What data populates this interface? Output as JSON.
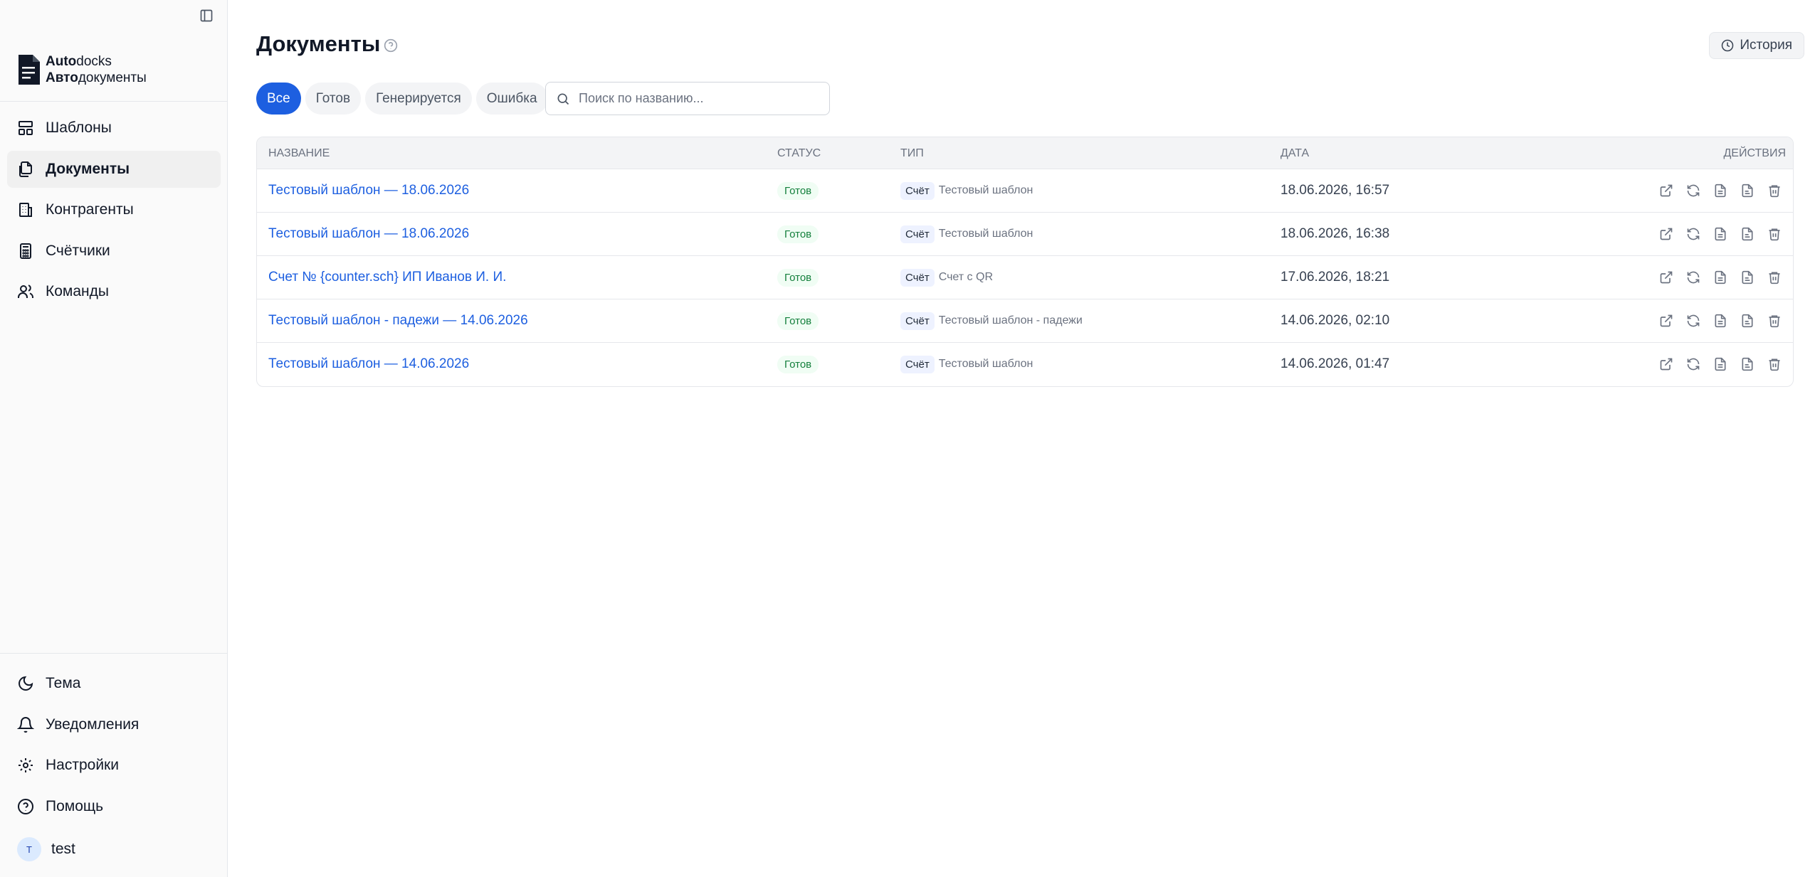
{
  "sidebar": {
    "logo": {
      "line1_bold": "Auto",
      "line1_rest": "docks",
      "line2_bold": "Авто",
      "line2_rest": "документы"
    },
    "nav": [
      {
        "label": "Шаблоны",
        "icon": "layout-icon",
        "active": false
      },
      {
        "label": "Документы",
        "icon": "documents-icon",
        "active": true
      },
      {
        "label": "Контрагенты",
        "icon": "building-icon",
        "active": false
      },
      {
        "label": "Счётчики",
        "icon": "calculator-icon",
        "active": false
      },
      {
        "label": "Команды",
        "icon": "users-icon",
        "active": false
      }
    ],
    "bottom_nav": [
      {
        "label": "Тема",
        "icon": "moon-icon"
      },
      {
        "label": "Уведомления",
        "icon": "bell-icon"
      },
      {
        "label": "Настройки",
        "icon": "gear-icon"
      },
      {
        "label": "Помощь",
        "icon": "help-circle-icon"
      }
    ],
    "user": {
      "initial": "T",
      "name": "test"
    }
  },
  "header": {
    "title": "Документы",
    "history_label": "История"
  },
  "filters": {
    "tabs": [
      "Все",
      "Готов",
      "Генерируется",
      "Ошибка"
    ],
    "active_index": 0,
    "search_placeholder": "Поиск по названию..."
  },
  "table": {
    "columns": {
      "name": "Название",
      "status": "Статус",
      "type": "Тип",
      "date": "Дата",
      "actions": "Действия"
    },
    "rows": [
      {
        "name": "Тестовый шаблон — 18.06.2026",
        "status": "Готов",
        "type": "Счёт",
        "template": "Тестовый шаблон",
        "date": "18.06.2026, 16:57"
      },
      {
        "name": "Тестовый шаблон — 18.06.2026",
        "status": "Готов",
        "type": "Счёт",
        "template": "Тестовый шаблон",
        "date": "18.06.2026, 16:38"
      },
      {
        "name": "Счет № {counter.sch} ИП Иванов И. И.",
        "status": "Готов",
        "type": "Счёт",
        "template": "Счет с QR",
        "date": "17.06.2026, 18:21"
      },
      {
        "name": "Тестовый шаблон - падежи — 14.06.2026",
        "status": "Готов",
        "type": "Счёт",
        "template": "Тестовый шаблон - падежи",
        "date": "14.06.2026, 02:10"
      },
      {
        "name": "Тестовый шаблон — 14.06.2026",
        "status": "Готов",
        "type": "Счёт",
        "template": "Тестовый шаблон",
        "date": "14.06.2026, 01:47"
      }
    ],
    "row_actions": [
      "external-link-icon",
      "refresh-icon",
      "file-text-icon",
      "file-icon",
      "trash-icon"
    ]
  },
  "colors": {
    "accent": "#1d5fe0",
    "status_ready_bg": "#f0fdf4",
    "status_ready_text": "#15803d"
  }
}
